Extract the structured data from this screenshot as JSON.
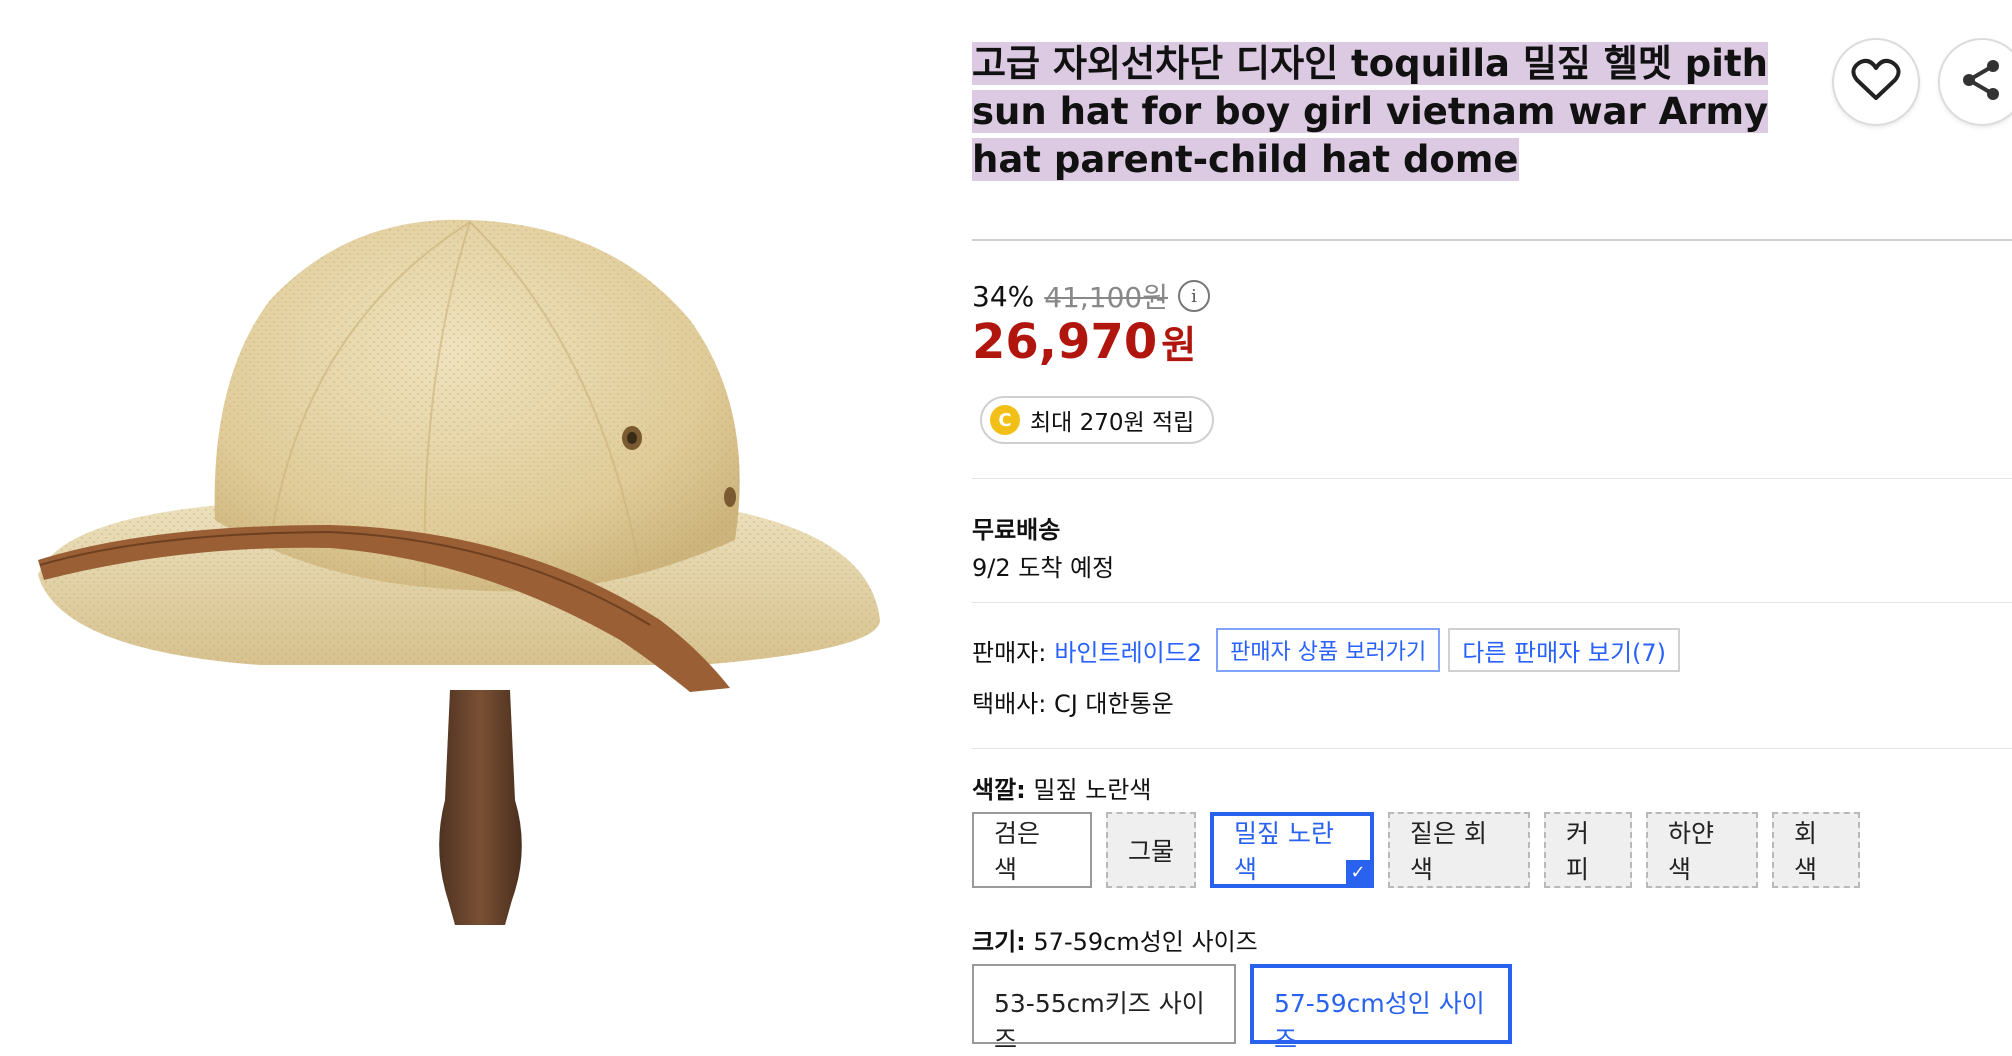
{
  "product": {
    "title": "고급 자외선차단 디자인 toquilla 밀짚 헬멧 pith sun hat for boy girl vietnam war Army hat parent-child hat dome"
  },
  "actions": {
    "wishlist_icon": "heart-icon",
    "share_icon": "share-icon"
  },
  "price": {
    "discount_rate": "34%",
    "original_price": "41,100원",
    "sale_price": "26,970",
    "currency": "원",
    "info_icon": "i"
  },
  "reward": {
    "coin_letter": "C",
    "text": "최대 270원 적립"
  },
  "shipping": {
    "label": "무료배송",
    "arrival": "9/2 도착 예정"
  },
  "seller": {
    "label": "판매자:",
    "name": "바인트레이드2",
    "view_products": "판매자 상품 보러가기",
    "other_sellers": "다른 판매자 보기(7)",
    "courier": "택배사: CJ 대한통운"
  },
  "color_option": {
    "label": "색깔:",
    "selected": "밀짚 노란색",
    "options": [
      "검은 색",
      "그물",
      "밀짚 노란색",
      "짙은 회색",
      "커피",
      "하얀색",
      "회색"
    ]
  },
  "size_option": {
    "label": "크기:",
    "selected": "57-59cm성인 사이즈",
    "options": [
      "53-55cm키즈 사이즈",
      "57-59cm성인 사이즈"
    ]
  },
  "colors": {
    "accent": "#2a62f0",
    "sale": "#b1160e",
    "title_highlight": "#dccae3",
    "coin": "#f2bf16"
  }
}
